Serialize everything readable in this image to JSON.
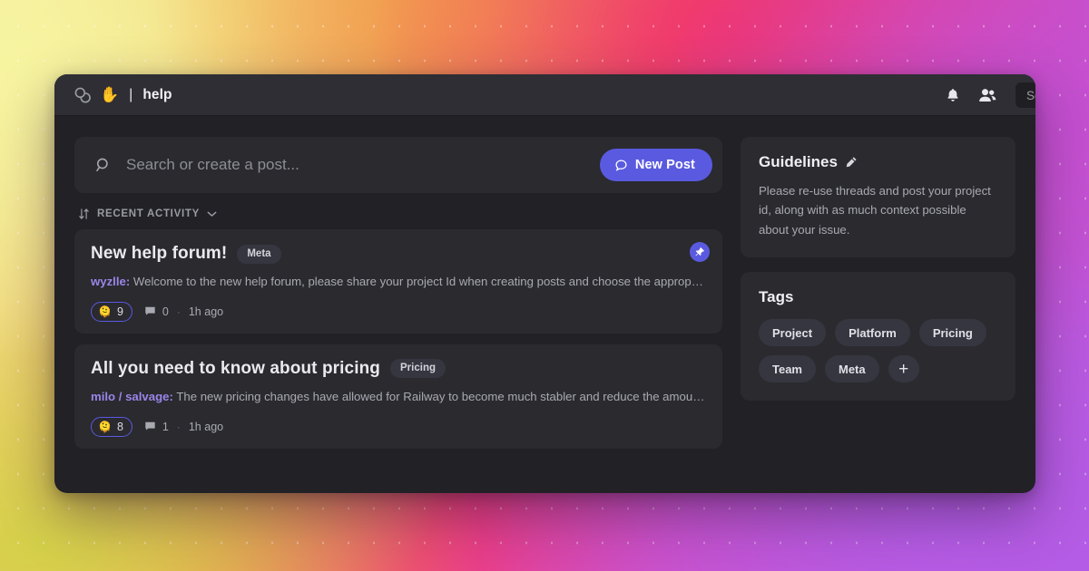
{
  "window": {
    "titlebar": {
      "forum_icon": "chat-bubbles-icon",
      "channel_emoji": "✋",
      "divider": "|",
      "channel_name": "help",
      "notifications_icon": "bell-icon",
      "members_icon": "people-icon",
      "search_value": "Sea"
    }
  },
  "main": {
    "search": {
      "placeholder": "Search or create a post...",
      "value": "",
      "icon": "search-icon"
    },
    "new_post": {
      "label": "New Post",
      "icon": "speech-bubble-icon",
      "color": "#5a5ae0"
    },
    "sort": {
      "icon": "sort-arrows-icon",
      "label": "RECENT ACTIVITY",
      "chevron": "chevron-down-icon"
    },
    "posts": [
      {
        "title": "New help forum!",
        "tag": "Meta",
        "pinned": true,
        "pin_icon": "pin-icon",
        "author": "wyzlle:",
        "excerpt": "Welcome to the new help forum, please share your project Id when creating posts and choose the appropriate tag tha...",
        "reaction_emoji": "🫠",
        "reaction_count": "9",
        "comment_icon": "comment-icon",
        "comment_count": "0",
        "separator": "·",
        "time": "1h ago"
      },
      {
        "title": "All you need to know about pricing",
        "tag": "Pricing",
        "pinned": false,
        "pin_icon": "",
        "author": "milo / salvage:",
        "excerpt": "The new pricing changes have allowed for Railway to become much stabler and reduce the amount of bad act...",
        "reaction_emoji": "🫠",
        "reaction_count": "8",
        "comment_icon": "comment-icon",
        "comment_count": "1",
        "separator": "·",
        "time": "1h ago"
      }
    ]
  },
  "sidebar": {
    "guidelines": {
      "title": "Guidelines",
      "edit_icon": "pencil-icon",
      "body": "Please re-use threads and post your project id, along with as much context possible about your issue."
    },
    "tags": {
      "title": "Tags",
      "items": [
        "Project",
        "Platform",
        "Pricing",
        "Team",
        "Meta"
      ],
      "add_label": "+"
    }
  },
  "theme": {
    "accent": "#5a5ae0",
    "author_color": "#9b85e8",
    "window_bg": "#212126",
    "card_bg": "#2a2a2f",
    "titlebar_bg": "#2e2e34"
  }
}
